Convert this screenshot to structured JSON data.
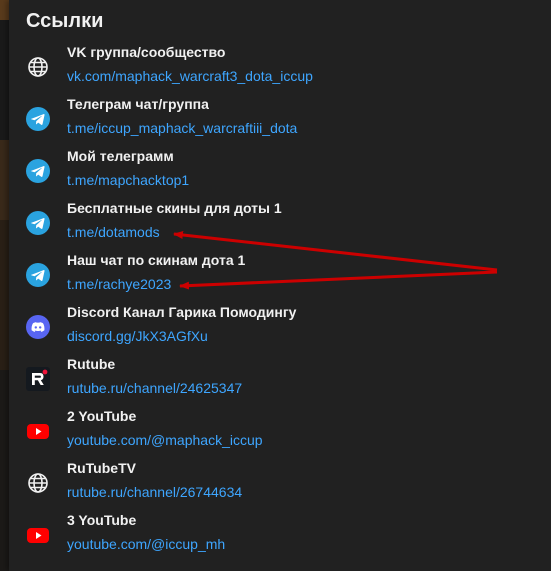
{
  "panel": {
    "title": "Ссылки"
  },
  "links": [
    {
      "icon": "globe-icon",
      "name": "VK группа/сообщество",
      "url": "vk.com/maphack_warcraft3_dota_iccup"
    },
    {
      "icon": "telegram-icon",
      "name": "Телеграм чат/группа",
      "url": "t.me/iccup_maphack_warcraftiii_dota"
    },
    {
      "icon": "telegram-icon",
      "name": "Мой телеграмм",
      "url": "t.me/mapchacktop1"
    },
    {
      "icon": "telegram-icon",
      "name": "Бесплатные скины для доты 1",
      "url": "t.me/dotamods"
    },
    {
      "icon": "telegram-icon",
      "name": "Наш чат по скинам дота 1",
      "url": "t.me/rachye2023"
    },
    {
      "icon": "discord-icon",
      "name": "Discord Канал Гарика Помодингу",
      "url": "discord.gg/JkX3AGfXu"
    },
    {
      "icon": "rutube-icon",
      "name": "Rutube",
      "url": "rutube.ru/channel/24625347"
    },
    {
      "icon": "youtube-icon",
      "name": "2 YouTube",
      "url": "youtube.com/@maphack_iccup"
    },
    {
      "icon": "globe-icon",
      "name": "RuTubeTV",
      "url": "rutube.ru/channel/26744634"
    },
    {
      "icon": "youtube-icon",
      "name": "3 YouTube",
      "url": "youtube.com/@iccup_mh"
    }
  ],
  "colors": {
    "panel_bg": "#212121",
    "text_primary": "#f1f1f1",
    "link": "#3ea6ff",
    "telegram": "#2aa3e0",
    "discord": "#5865f2",
    "youtube": "#ff0000",
    "rutube_bg": "#14191f",
    "rutube_accent": "#ed143b",
    "annotation_arrow": "#cc0000"
  }
}
